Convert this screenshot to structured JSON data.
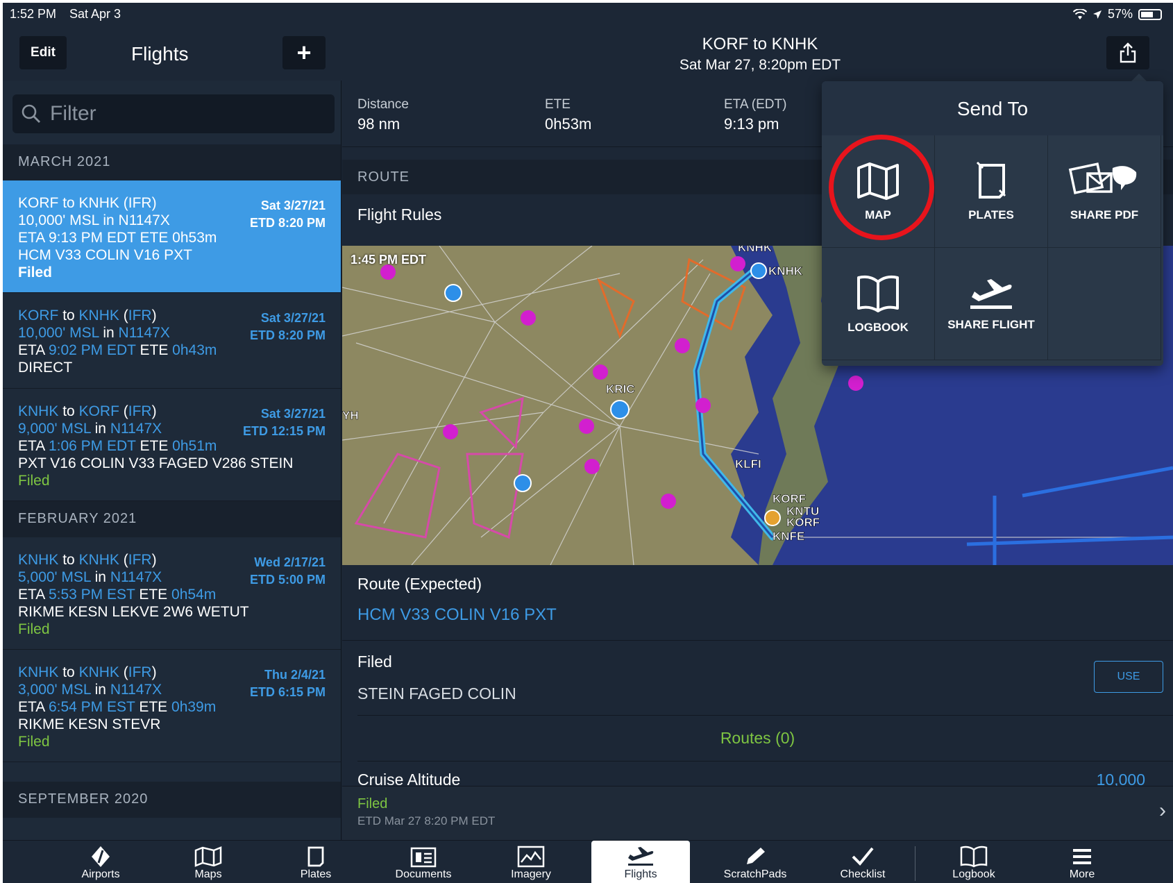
{
  "status_bar": {
    "time": "1:52 PM",
    "date": "Sat Apr 3",
    "battery": "57%"
  },
  "header": {
    "edit_label": "Edit",
    "list_title": "Flights",
    "add_label": "+",
    "title": "KORF to KNHK",
    "subtitle": "Sat Mar 27, 8:20pm EDT"
  },
  "sidebar": {
    "filter_placeholder": "Filter",
    "sections": [
      "MARCH 2021",
      "FEBRUARY 2021",
      "SEPTEMBER 2020"
    ],
    "flights": [
      {
        "from": "KORF",
        "to": "KNHK",
        "rules": "IFR",
        "altitude": "10,000' MSL",
        "aircraft": "N1147X",
        "eta": "9:13 PM EDT",
        "ete": "0h53m",
        "route": "HCM V33 COLIN V16 PXT",
        "status": "Filed",
        "date": "Sat 3/27/21",
        "etd": "ETD 8:20 PM"
      },
      {
        "from": "KORF",
        "to": "KNHK",
        "rules": "IFR",
        "altitude": "10,000' MSL",
        "aircraft": "N1147X",
        "eta": "9:02 PM EDT",
        "ete": "0h43m",
        "route": "DIRECT",
        "status": "",
        "date": "Sat 3/27/21",
        "etd": "ETD 8:20 PM"
      },
      {
        "from": "KNHK",
        "to": "KORF",
        "rules": "IFR",
        "altitude": "9,000' MSL",
        "aircraft": "N1147X",
        "eta": "1:06 PM EDT",
        "ete": "0h51m",
        "route": "PXT V16 COLIN V33 FAGED V286 STEIN",
        "status": "Filed",
        "date": "Sat 3/27/21",
        "etd": "ETD 12:15 PM"
      },
      {
        "from": "KNHK",
        "to": "KNHK",
        "rules": "IFR",
        "altitude": "5,000' MSL",
        "aircraft": "N1147X",
        "eta": "5:53 PM EST",
        "ete": "0h54m",
        "route": "RIKME KESN LEKVE 2W6 WETUT",
        "status": "Filed",
        "date": "Wed 2/17/21",
        "etd": "ETD 5:00 PM"
      },
      {
        "from": "KNHK",
        "to": "KNHK",
        "rules": "IFR",
        "altitude": "3,000' MSL",
        "aircraft": "N1147X",
        "eta": "6:54 PM EST",
        "ete": "0h39m",
        "route": "RIKME KESN STEVR",
        "status": "Filed",
        "date": "Thu 2/4/21",
        "etd": "ETD 6:15 PM"
      }
    ],
    "words": {
      "to": "to",
      "in": "in",
      "eta": "ETA",
      "ete": "ETE"
    }
  },
  "details": {
    "stats": [
      {
        "label": "Distance",
        "value": "98 nm"
      },
      {
        "label": "ETE",
        "value": "0h53m"
      },
      {
        "label": "ETA (EDT)",
        "value": "9:13 pm"
      }
    ],
    "route_header": "ROUTE",
    "flight_rules_label": "Flight Rules",
    "map_time": "1:45 PM EDT",
    "map_labels": [
      "KNHK",
      "KNHK",
      "KRIC",
      "KLFI",
      "KORF",
      "KNTU",
      "KORF",
      "KNFE",
      "YH"
    ],
    "route_expected_label": "Route (Expected)",
    "route_expected_value": "HCM V33 COLIN V16 PXT",
    "filed_label": "Filed",
    "filed_value": "STEIN FAGED COLIN",
    "use_label": "USE",
    "routes_count": "Routes (0)",
    "cruise_label": "Cruise Altitude",
    "cruise_value": "10,000",
    "footer_status": "Filed",
    "footer_etd": "ETD Mar 27 8:20 PM EDT"
  },
  "send_to": {
    "title": "Send To",
    "items": [
      {
        "label": "MAP",
        "icon": "map-icon"
      },
      {
        "label": "PLATES",
        "icon": "plates-icon"
      },
      {
        "label": "SHARE PDF",
        "icon": "share-pdf-icon"
      },
      {
        "label": "LOGBOOK",
        "icon": "logbook-icon"
      },
      {
        "label": "SHARE FLIGHT",
        "icon": "share-flight-icon"
      }
    ],
    "highlight_color": "#e8141c"
  },
  "tabbar": {
    "tabs": [
      "Airports",
      "Maps",
      "Plates",
      "Documents",
      "Imagery",
      "Flights",
      "ScratchPads",
      "Checklist",
      "Logbook",
      "More"
    ],
    "active": "Flights"
  },
  "colors": {
    "accent": "#3e9be5",
    "filed_green": "#7ec542",
    "background": "#1c2736"
  }
}
